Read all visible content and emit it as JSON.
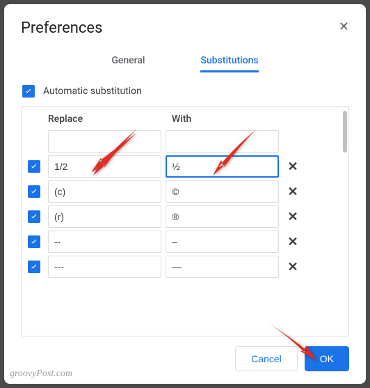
{
  "title": "Preferences",
  "tabs": {
    "general": "General",
    "substitutions": "Substitutions"
  },
  "auto_label": "Automatic substitution",
  "auto_checked": true,
  "columns": {
    "replace": "Replace",
    "with": "With"
  },
  "rows": [
    {
      "checked": false,
      "replace": "",
      "with": "",
      "deletable": false
    },
    {
      "checked": true,
      "replace": "1/2",
      "with": "½",
      "deletable": true,
      "focused": true
    },
    {
      "checked": true,
      "replace": "(c)",
      "with": "©",
      "deletable": true
    },
    {
      "checked": true,
      "replace": "(r)",
      "with": "®",
      "deletable": true
    },
    {
      "checked": true,
      "replace": "--",
      "with": "–",
      "deletable": true
    },
    {
      "checked": true,
      "replace": "---",
      "with": "—",
      "deletable": true
    }
  ],
  "buttons": {
    "cancel": "Cancel",
    "ok": "OK"
  },
  "watermark": "groovyPost.com"
}
